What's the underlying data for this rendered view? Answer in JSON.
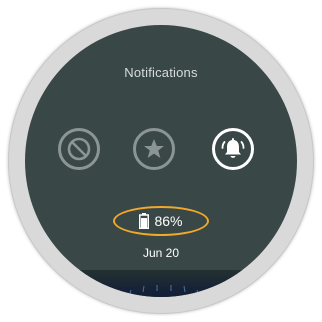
{
  "screen": {
    "title": "Notifications",
    "modes": [
      {
        "id": "none",
        "icon": "block-icon",
        "active": false
      },
      {
        "id": "priority",
        "icon": "star-icon",
        "active": false
      },
      {
        "id": "all",
        "icon": "bell-icon",
        "active": true
      }
    ],
    "battery": {
      "icon": "battery-icon",
      "percent": "86%",
      "level": 0.86,
      "highlight_color": "#f0a928"
    },
    "date": "Jun 20"
  },
  "colors": {
    "screen_background": "#3a4747",
    "inactive_icon": "#8b9595",
    "active_icon": "#ffffff"
  }
}
